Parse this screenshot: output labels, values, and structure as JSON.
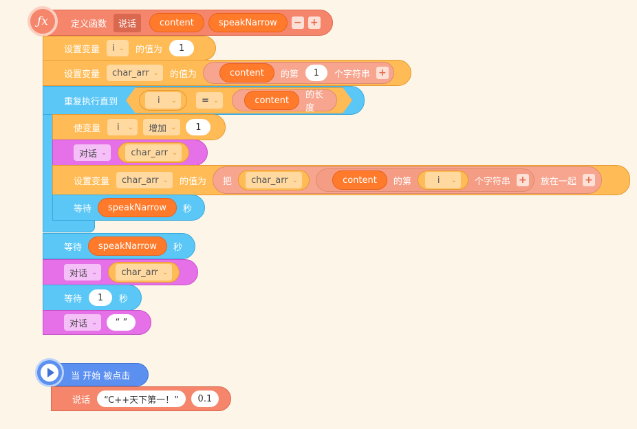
{
  "define_block": {
    "label": "定义函数",
    "func_name": "说话",
    "params": [
      "content",
      "speakNarrow"
    ],
    "fx_icon": "ƒx"
  },
  "set_i": {
    "label": "设置变量",
    "var": "i",
    "value_label": "的值为",
    "value": "1"
  },
  "set_char": {
    "label": "设置变量",
    "var": "char_arr",
    "value_label": "的值为",
    "reporter": "content",
    "of_label": "的第",
    "index": "1",
    "char_label": "个字符串"
  },
  "repeat_until": {
    "label": "重复执行直到",
    "left_var": "i",
    "op": "=",
    "reporter": "content",
    "length_label": "的长度"
  },
  "change_i": {
    "label": "使变量",
    "var": "i",
    "action": "增加",
    "value": "1"
  },
  "say_inner": {
    "label": "对话",
    "value": "char_arr"
  },
  "set_join": {
    "label": "设置变量",
    "var": "char_arr",
    "value_label": "的值为",
    "join_label": "把",
    "join_var": "char_arr",
    "reporter": "content",
    "of_label": "的第",
    "index_var": "i",
    "char_label": "个字符串",
    "together_label": "放在一起"
  },
  "wait_inner": {
    "label": "等待",
    "reporter": "speakNarrow",
    "unit": "秒"
  },
  "wait_outer": {
    "label": "等待",
    "reporter": "speakNarrow",
    "unit": "秒"
  },
  "say_outer": {
    "label": "对话",
    "value": "char_arr"
  },
  "wait_one": {
    "label": "等待",
    "value": "1",
    "unit": "秒"
  },
  "say_empty": {
    "label": "对话",
    "value": "“ ”"
  },
  "hat": {
    "label": "当 开始 被点击"
  },
  "call_speak": {
    "label": "说话",
    "arg1": "“C++天下第一！”",
    "arg2": "0.1"
  }
}
